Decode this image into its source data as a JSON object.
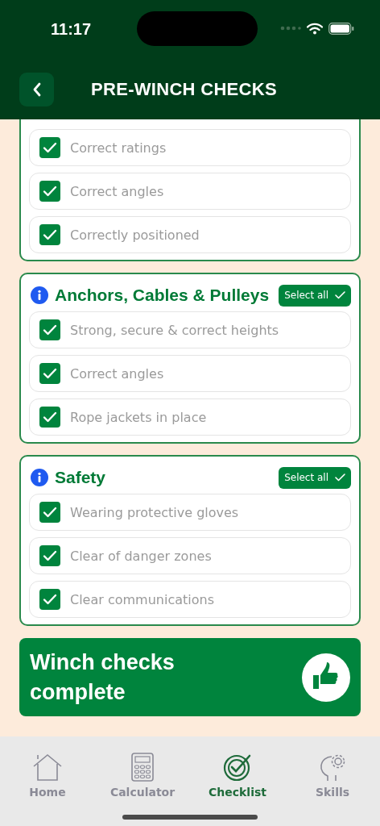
{
  "status_bar": {
    "time": "11:17"
  },
  "header": {
    "title": "PRE-WINCH CHECKS"
  },
  "sections": [
    {
      "items": [
        {
          "label": "Correct ratings",
          "checked": true
        },
        {
          "label": "Correct angles",
          "checked": true
        },
        {
          "label": "Correctly positioned",
          "checked": true
        }
      ]
    },
    {
      "title": "Anchors, Cables & Pulleys",
      "select_all": "Select all",
      "items": [
        {
          "label": "Strong, secure & correct heights",
          "checked": true
        },
        {
          "label": "Correct angles",
          "checked": true
        },
        {
          "label": "Rope jackets in place",
          "checked": true
        }
      ]
    },
    {
      "title": "Safety",
      "select_all": "Select all",
      "items": [
        {
          "label": "Wearing protective gloves",
          "checked": true
        },
        {
          "label": "Clear of danger zones",
          "checked": true
        },
        {
          "label": "Clear communications",
          "checked": true
        }
      ]
    }
  ],
  "complete_banner": {
    "text": "Winch checks complete"
  },
  "tab_bar": [
    {
      "label": "Home",
      "kind": "home",
      "selected": false
    },
    {
      "label": "Calculator",
      "kind": "calculator",
      "selected": false
    },
    {
      "label": "Checklist",
      "kind": "checklist",
      "selected": true
    },
    {
      "label": "Skills",
      "kind": "skills",
      "selected": false
    }
  ]
}
